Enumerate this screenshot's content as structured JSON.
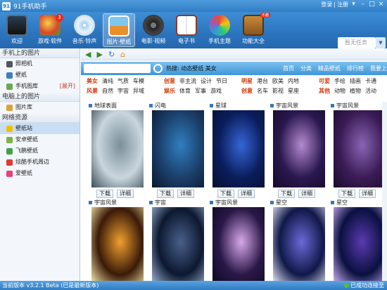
{
  "app": {
    "title": "91手机助手",
    "login": "登录",
    "register": "注册",
    "separator": "|"
  },
  "toolbar": {
    "buttons": [
      {
        "label": "欢迎"
      },
      {
        "label": "游戏·软件",
        "badge": "3"
      },
      {
        "label": "音乐·铃声"
      },
      {
        "label": "图片·壁纸"
      },
      {
        "label": "电影·视频"
      },
      {
        "label": "电子书"
      },
      {
        "label": "手机主题"
      },
      {
        "label": "功能大全",
        "tag": "乐趣"
      }
    ],
    "search_placeholder": "暂无任务"
  },
  "sidebar": {
    "section_phone": "手机上的图片",
    "phone_items": [
      {
        "label": "照相机"
      },
      {
        "label": "壁纸"
      },
      {
        "label": "手机图库",
        "expand": "[展开]"
      }
    ],
    "section_pc": "电脑上的图片",
    "pc_items": [
      {
        "label": "图片库"
      }
    ],
    "section_net": "网络资源",
    "net_items": [
      {
        "label": "壁纸站"
      },
      {
        "label": "安卓壁纸"
      },
      {
        "label": "飞鹏壁纸"
      },
      {
        "label": "炫酷手机周边"
      },
      {
        "label": "爱壁纸"
      }
    ]
  },
  "main": {
    "hot_label": "热搜:",
    "hot_terms": "动态壁纸   美女",
    "links": [
      "首页",
      "分类",
      "精品壁纸",
      "排行榜",
      "我要上"
    ],
    "categories": [
      [
        "美女",
        "清纯",
        "气质",
        "车模"
      ],
      [
        "风景",
        "自然",
        "宇宙",
        "异域"
      ],
      [
        "创意",
        "非主流",
        "设计",
        "节日"
      ],
      [
        "娱乐",
        "体育",
        "军事",
        "游戏"
      ],
      [
        "明星",
        "港台",
        "欧美",
        "内地"
      ],
      [
        "创意",
        "名车",
        "影视",
        "星座"
      ],
      [
        "可爱",
        "手绘",
        "插画",
        "卡通"
      ],
      [
        "其他",
        "动物",
        "植物",
        "活动"
      ]
    ],
    "download": "下载",
    "detail": "详细",
    "wallpapers": [
      {
        "title": "地球表面"
      },
      {
        "title": "闪电"
      },
      {
        "title": "星球"
      },
      {
        "title": "宇宙风景"
      },
      {
        "title": "宇宙风景"
      },
      {
        "title": "宇宙风景"
      },
      {
        "title": "宇宙"
      },
      {
        "title": "宇宙风景"
      },
      {
        "title": "星空"
      },
      {
        "title": "星空"
      }
    ]
  },
  "status": {
    "version_label": "当前版本",
    "version": "v3.2.1 Beta",
    "note": "(已是最新版本)",
    "right": "已成功连接至"
  }
}
